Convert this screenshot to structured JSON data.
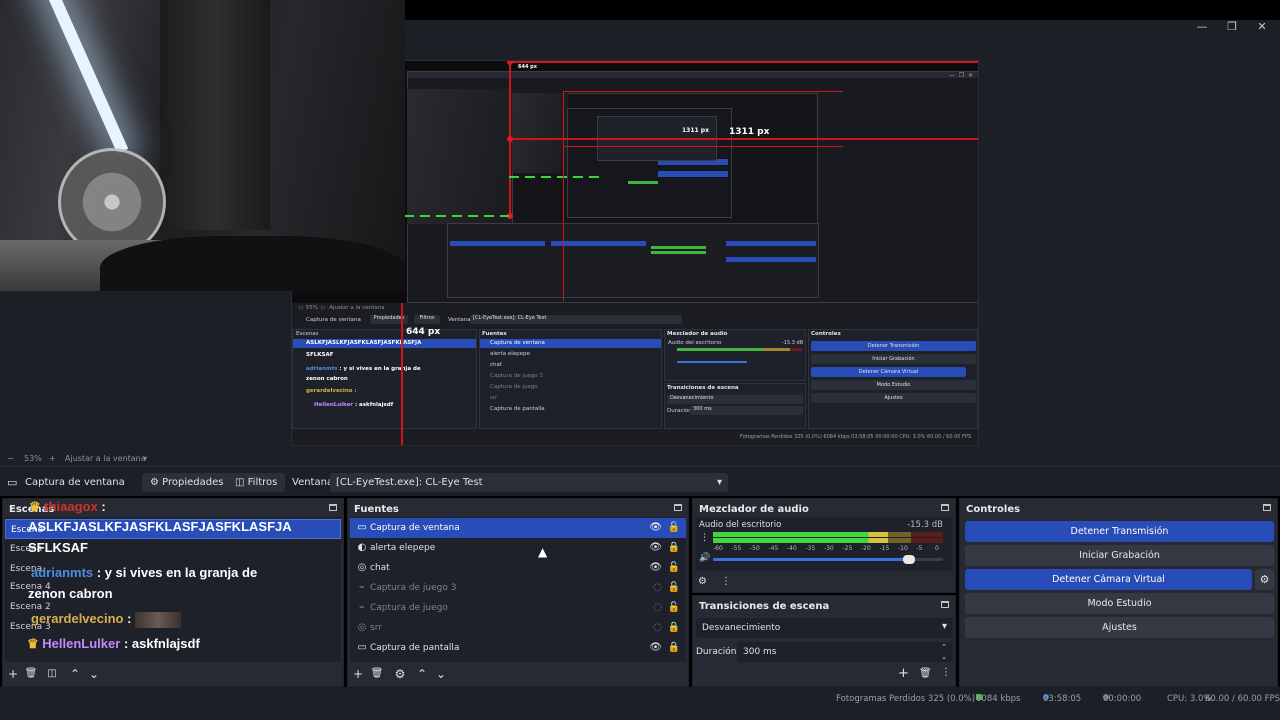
{
  "window": {
    "minimize": "—",
    "maximize": "❐",
    "close": "✕"
  },
  "preview": {
    "measure_horizontal": "1311 px",
    "measure_vertical": "644 px",
    "mini_measure_horizontal": "1311 px",
    "mini_measure_vertical": "644 px",
    "mini": {
      "tab_source": "Captura de ventana",
      "properties": "Propiedades",
      "filters": "Filtros",
      "window_label": "Ventana",
      "window_value": "[CL-EyeTest.exe]: CL-Eye Test",
      "sources_title": "Fuentes",
      "mixer_title": "Mezclador de audio",
      "controls_title": "Controles",
      "transitions_title": "Transiciones de escena",
      "transition_value": "Desvanecimiento",
      "duration_label": "Duración",
      "duration_value": "300 ms",
      "audio_label": "Audio del escritorio",
      "audio_db": "-15.3 dB",
      "sources": [
        "Captura de ventana",
        "alerta elepepe",
        "chat",
        "Captura de juego 3",
        "Captura de juego",
        "srr",
        "Captura de pantalla"
      ],
      "controls": [
        "Detener Transmisión",
        "Iniciar Grabación",
        "Detener Cámara Virtual",
        "Modo Estudio",
        "Ajustes"
      ],
      "status": "Fotogramas Perdidos 325 (0.0%)   6084 kbps   03:58:05   00:00:00   CPU: 3.0%   60.00 / 60.00 FPS"
    }
  },
  "zoombar": {
    "minus": "−",
    "zoom": "53%",
    "plus": "+",
    "fit": "Ajustar a la ventana",
    "caret": "▾"
  },
  "context": {
    "source_name": "Captura de ventana",
    "properties_label": "Propiedades",
    "filters_label": "Filtros",
    "window_label": "Ventana",
    "window_value": "[CL-EyeTest.exe]: CL-Eye Test"
  },
  "scenes": {
    "title": "Escenas",
    "rows": [
      "Escena",
      "Escena",
      "Escena",
      "Escena 4",
      "Escena 2",
      "Escena 3"
    ],
    "chat": [
      {
        "user": "thiaagox",
        "text": ":",
        "user_color": "#d0312d"
      },
      {
        "user": "",
        "text": "ASLKFJASLKFJASFKLASFJASFKLASFJA",
        "user_color": "#ffffff"
      },
      {
        "user": "",
        "text": "SFLKSAF",
        "user_color": "#ffffff"
      },
      {
        "user": "adrianmts",
        "text": ": y si vives en la granja de",
        "user_color": "#4a8fe0"
      },
      {
        "user": "",
        "text": "zenon cabron",
        "user_color": "#ffffff"
      },
      {
        "user": "gerardelvecino",
        "text": ":",
        "user_color": "#d8b04a"
      },
      {
        "user": "HellenLulker",
        "text": ": askfnlajsdf",
        "user_color": "#c689ff"
      }
    ]
  },
  "sources": {
    "title": "Fuentes",
    "items": [
      {
        "label": "Captura de ventana",
        "icon": "▭",
        "visible": true,
        "locked": false,
        "selected": true
      },
      {
        "label": "alerta elepepe",
        "icon": "◐",
        "visible": true,
        "locked": true,
        "selected": false
      },
      {
        "label": "chat",
        "icon": "◎",
        "visible": true,
        "locked": false,
        "selected": false
      },
      {
        "label": "Captura de juego 3",
        "icon": "⌁",
        "visible": false,
        "locked": false,
        "selected": false
      },
      {
        "label": "Captura de juego",
        "icon": "⌁",
        "visible": false,
        "locked": false,
        "selected": false
      },
      {
        "label": "srr",
        "icon": "◎",
        "visible": false,
        "locked": true,
        "selected": false
      },
      {
        "label": "Captura de pantalla",
        "icon": "▭",
        "visible": true,
        "locked": true,
        "selected": false
      }
    ]
  },
  "mixer": {
    "title": "Mezclador de audio",
    "channel": "Audio del escritorio",
    "db": "-15.3 dB",
    "ticks": [
      "-60",
      "-55",
      "-50",
      "-45",
      "-40",
      "-35",
      "-30",
      "-25",
      "-20",
      "-15",
      "-10",
      "-5",
      "0"
    ],
    "volume_fraction": 0.85,
    "level_fraction": 0.76,
    "mute_icon": "🔊",
    "gear_icon": "⚙",
    "menu_icon": "⋮"
  },
  "transitions": {
    "title": "Transiciones de escena",
    "selected": "Desvanecimiento",
    "duration_label": "Duración",
    "duration_value": "300 ms"
  },
  "controls": {
    "title": "Controles",
    "buttons": [
      {
        "label": "Detener Transmisión",
        "active": true
      },
      {
        "label": "Iniciar Grabación",
        "active": false
      },
      {
        "label": "Detener Cámara Virtual",
        "active": true
      },
      {
        "label": "Modo Estudio",
        "active": false
      },
      {
        "label": "Ajustes",
        "active": false
      }
    ],
    "virtual_cam_settings_icon": "⚙"
  },
  "status": {
    "dropped": "Fotogramas Perdidos 325 (0.0%)",
    "bitrate": "6084 kbps",
    "stream_time": "03:58:05",
    "record_time": "00:00:00",
    "cpu": "CPU: 3.0%",
    "fps": "60.00 / 60.00 FPS",
    "colors": {
      "bitrate": "#3fb63f",
      "stream": "#3a6fe0",
      "record": "#6b6f78"
    }
  }
}
